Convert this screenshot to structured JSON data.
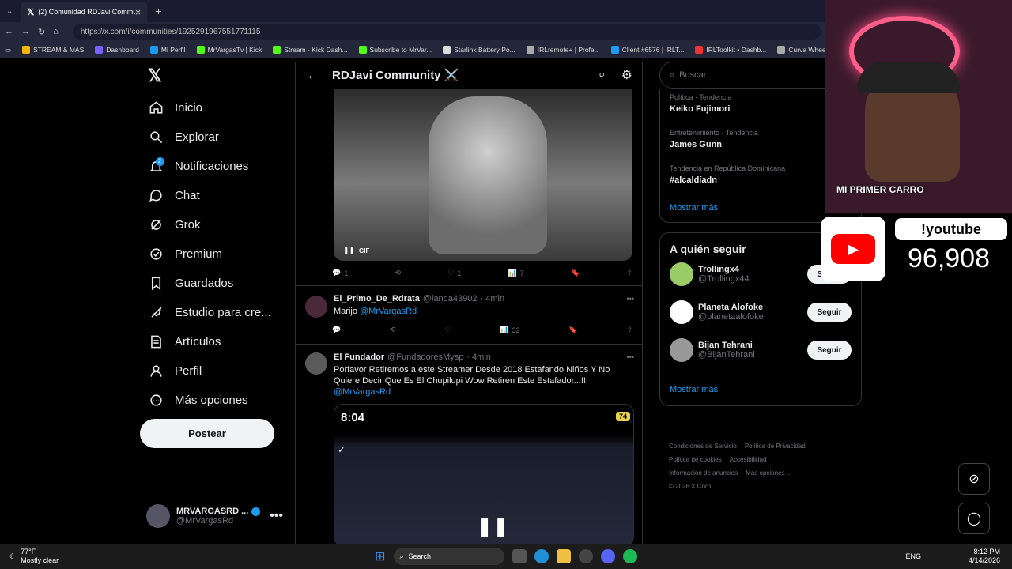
{
  "browser": {
    "tab_title": "(2) Comunidad RDJavi Community",
    "url": "https://x.com/i/communities/1925291967551771115",
    "bookmarks": [
      "STREAM & MAS",
      "Dashboard",
      "Mi Perfil",
      "MrVargasTv | Kick",
      "Stream - Kick Dash...",
      "Subscribe to MrVar...",
      "Starlink Battery Po...",
      "IRLremote+ | Profe...",
      "Client #6576 | IRLT...",
      "IRLToolkit • Dashb...",
      "Curva Wheels CFF76"
    ]
  },
  "nav": {
    "items": [
      {
        "label": "Inicio",
        "icon": "home-icon"
      },
      {
        "label": "Explorar",
        "icon": "search-icon"
      },
      {
        "label": "Notificaciones",
        "icon": "bell-icon",
        "badge": "2"
      },
      {
        "label": "Chat",
        "icon": "chat-icon"
      },
      {
        "label": "Grok",
        "icon": "grok-icon"
      },
      {
        "label": "Premium",
        "icon": "premium-icon"
      },
      {
        "label": "Guardados",
        "icon": "bookmark-icon"
      },
      {
        "label": "Estudio para cre...",
        "icon": "rocket-icon"
      },
      {
        "label": "Artículos",
        "icon": "article-icon"
      },
      {
        "label": "Perfil",
        "icon": "person-icon"
      },
      {
        "label": "Más opciones",
        "icon": "more-icon"
      }
    ],
    "post_button": "Postear",
    "profile_name": "MRVARGASRD ...",
    "profile_handle": "@MrVargasRd"
  },
  "center": {
    "title": "RDJavi Community ⚔️",
    "gif_label": "GIF",
    "post1_stats": {
      "replies": "1",
      "likes": "1",
      "views": "7"
    },
    "post2": {
      "name": "El_Primo_De_Rdrata",
      "handle": "@landa43902",
      "time": "· 4min",
      "text": "Marijo",
      "mention": "@MrVargasRd",
      "views": "32"
    },
    "post3": {
      "name": "El Fundador",
      "handle": "@FundadoresMysp",
      "time": "· 4min",
      "text": "Porfavor Retiremos a este Streamer Desde 2018 Estafando Niños Y No Quiere Decir Que Es El Chupilupi Wow Retiren Este Estafador...!!!",
      "mention": "@MrVargasRd",
      "phone_time": "8:04",
      "battery": "74"
    }
  },
  "right": {
    "search_placeholder": "Buscar",
    "trends": [
      {
        "meta": "Política · Tendencia",
        "title": "Keiko Fujimori"
      },
      {
        "meta": "Entretenimiento · Tendencia",
        "title": "James Gunn"
      },
      {
        "meta": "Tendencia en República Dominicana",
        "title": "#alcaldíadn"
      }
    ],
    "show_more": "Mostrar más",
    "who_to_follow": "A quién seguir",
    "follow_label": "Seguir",
    "accounts": [
      {
        "name": "Trollingx4",
        "handle": "@Trollingx44"
      },
      {
        "name": "Planeta Alofoke",
        "handle": "@planetaalofoke"
      },
      {
        "name": "Bijan Tehrani",
        "handle": "@BijanTehrani"
      }
    ],
    "show_more2": "Mostrar más",
    "footer": [
      "Condiciones de Servicio",
      "Política de Privacidad",
      "Política de cookies",
      "Accesibilidad",
      "Información de anuncios",
      "Más opciones ...",
      "© 2026 X Corp."
    ]
  },
  "overlay": {
    "cam_caption": "MI PRIMER CARRO",
    "yt_label": "!youtube",
    "yt_count": "96,908"
  },
  "taskbar": {
    "weather_temp": "77°F",
    "weather_desc": "Mostly clear",
    "search": "Search",
    "lang": "ENG",
    "time": "8:12 PM",
    "date": "4/14/2026"
  }
}
